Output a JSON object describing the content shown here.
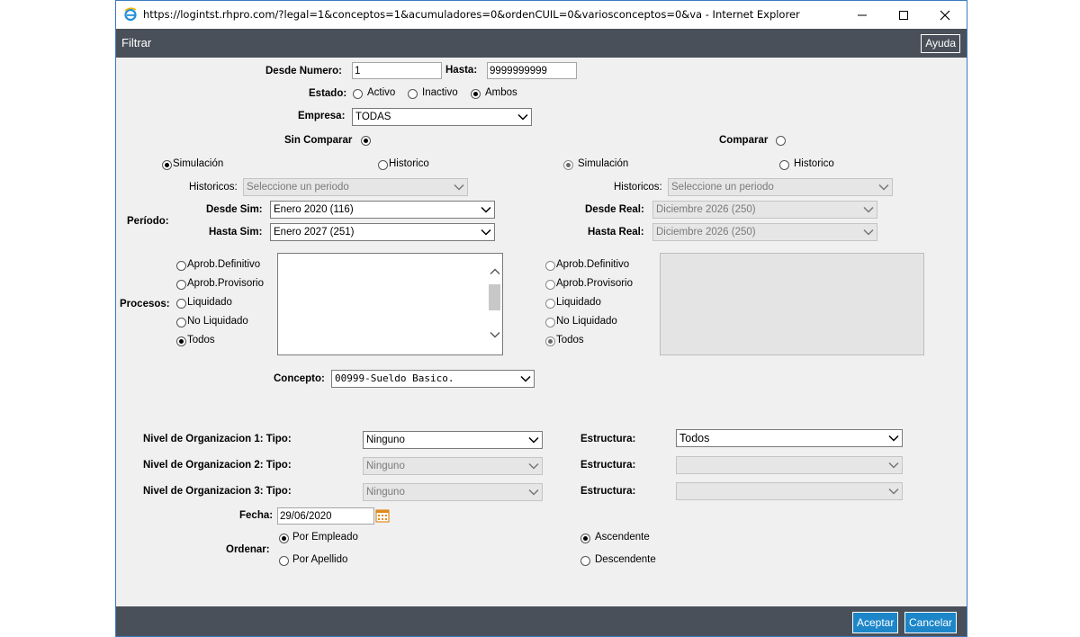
{
  "window": {
    "title": "https://logintst.rhpro.com/?legal=1&conceptos=1&acumuladores=0&ordenCUIL=0&variosconceptos=0&va - Internet Explorer",
    "minimize": "—",
    "maximize": "☐",
    "close": "✕"
  },
  "header": {
    "title": "Filtrar",
    "help_label": "Ayuda"
  },
  "range": {
    "desde_label": "Desde Numero:",
    "desde_value": "1",
    "hasta_label": "Hasta:",
    "hasta_value": "9999999999"
  },
  "estado": {
    "label": "Estado:",
    "options": [
      "Activo",
      "Inactivo",
      "Ambos"
    ],
    "selected": "Ambos"
  },
  "empresa": {
    "label": "Empresa:",
    "value": "TODAS"
  },
  "left": {
    "mode_label": "Sin Comparar",
    "sim_label": "Simulación",
    "hist_label": "Historico",
    "historicos_label": "Historicos:",
    "historicos_value": "Seleccione un periodo",
    "periodo_label": "Período:",
    "desde_label": "Desde Sim:",
    "desde_value": "Enero 2020 (116)",
    "hasta_label": "Hasta Sim:",
    "hasta_value": "Enero 2027 (251)"
  },
  "right": {
    "mode_label": "Comparar",
    "sim_label": "Simulación",
    "hist_label": "Historico",
    "historicos_label": "Historicos:",
    "historicos_value": "Seleccione un periodo",
    "desde_label": "Desde Real:",
    "desde_value": "Diciembre 2026 (250)",
    "hasta_label": "Hasta Real:",
    "hasta_value": "Diciembre 2026 (250)"
  },
  "procesos": {
    "label": "Procesos:",
    "options": [
      "Aprob.Definitivo",
      "Aprob.Provisorio",
      "Liquidado",
      "No Liquidado",
      "Todos"
    ],
    "selected": "Todos"
  },
  "concepto": {
    "label": "Concepto:",
    "value": "00999-Sueldo Basico."
  },
  "org": [
    {
      "label": "Nivel de Organizacion 1: Tipo:",
      "tipo": "Ninguno",
      "estructura_label": "Estructura:",
      "estructura": "Todos"
    },
    {
      "label": "Nivel de Organizacion 2: Tipo:",
      "tipo": "Ninguno",
      "estructura_label": "Estructura:",
      "estructura": ""
    },
    {
      "label": "Nivel de Organizacion 3: Tipo:",
      "tipo": "Ninguno",
      "estructura_label": "Estructura:",
      "estructura": ""
    }
  ],
  "fecha": {
    "label": "Fecha:",
    "value": "29/06/2020"
  },
  "ordenar": {
    "label": "Ordenar:",
    "by": [
      "Por Empleado",
      "Por Apellido"
    ],
    "by_selected": "Por Empleado",
    "dir": [
      "Ascendente",
      "Descendente"
    ],
    "dir_selected": "Ascendente"
  },
  "footer": {
    "accept_label": "Aceptar",
    "cancel_label": "Cancelar"
  },
  "colors": {
    "header_bg": "#4a5059",
    "button_bg": "#1c86c9",
    "content_bg": "#f0f0f0"
  }
}
